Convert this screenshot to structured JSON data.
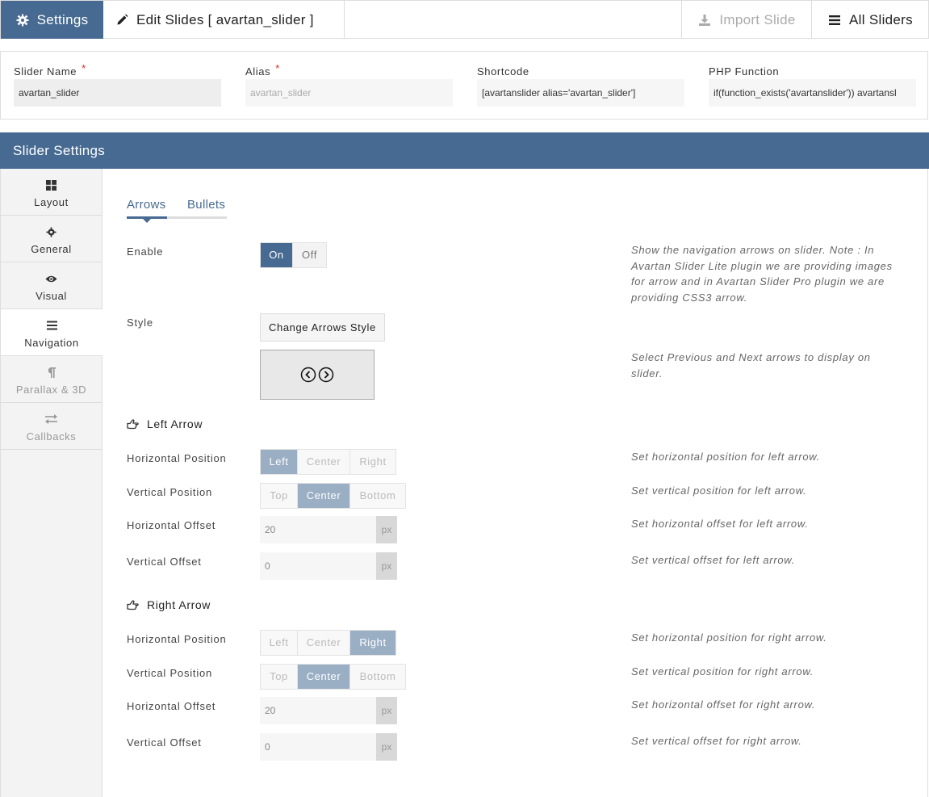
{
  "topbar": {
    "settings_label": "Settings",
    "edit_label": "Edit Slides [ avartan_slider ]",
    "import_label": "Import Slide",
    "all_label": "All Sliders"
  },
  "fields": {
    "slider_name": {
      "label": "Slider Name",
      "required": "*",
      "value": "avartan_slider"
    },
    "alias": {
      "label": "Alias",
      "required": "*",
      "value": "avartan_slider"
    },
    "shortcode": {
      "label": "Shortcode",
      "value": "[avartanslider alias='avartan_slider']"
    },
    "php": {
      "label": "PHP Function",
      "value": "if(function_exists('avartanslider')) avartansl"
    }
  },
  "settings_title": "Slider Settings",
  "sidebar": {
    "items": [
      {
        "label": "Layout",
        "icon": "grid-icon"
      },
      {
        "label": "General",
        "icon": "gear-icon"
      },
      {
        "label": "Visual",
        "icon": "eye-icon"
      },
      {
        "label": "Navigation",
        "icon": "bars-icon"
      },
      {
        "label": "Parallax & 3D",
        "icon": "paragraph-icon"
      },
      {
        "label": "Callbacks",
        "icon": "exchange-icon"
      }
    ]
  },
  "subtabs": [
    "Arrows",
    "Bullets"
  ],
  "enable": {
    "label": "Enable",
    "on": "On",
    "off": "Off",
    "desc": "Show the navigation arrows on slider. Note : In Avartan Slider Lite plugin we are providing images for arrow and in Avartan Slider Pro plugin we are providing CSS3 arrow."
  },
  "style": {
    "label": "Style",
    "button": "Change Arrows Style",
    "desc": "Select Previous and Next arrows to display on slider."
  },
  "left_arrow": {
    "title": "Left Arrow",
    "hpos": {
      "label": "Horizontal Position",
      "options": [
        "Left",
        "Center",
        "Right"
      ],
      "desc": "Set horizontal position for left arrow."
    },
    "vpos": {
      "label": "Vertical Position",
      "options": [
        "Top",
        "Center",
        "Bottom"
      ],
      "desc": "Set vertical position for left arrow."
    },
    "hoff": {
      "label": "Horizontal Offset",
      "value": "20",
      "unit": "px",
      "desc": "Set horizontal offset for left arrow."
    },
    "voff": {
      "label": "Vertical Offset",
      "value": "0",
      "unit": "px",
      "desc": "Set vertical offset for left arrow."
    }
  },
  "right_arrow": {
    "title": "Right Arrow",
    "hpos": {
      "label": "Horizontal Position",
      "options": [
        "Left",
        "Center",
        "Right"
      ],
      "desc": "Set horizontal position for right arrow."
    },
    "vpos": {
      "label": "Vertical Position",
      "options": [
        "Top",
        "Center",
        "Bottom"
      ],
      "desc": "Set vertical position for right arrow."
    },
    "hoff": {
      "label": "Horizontal Offset",
      "value": "20",
      "unit": "px",
      "desc": "Set horizontal offset for right arrow."
    },
    "voff": {
      "label": "Vertical Offset",
      "value": "0",
      "unit": "px",
      "desc": "Set vertical offset for right arrow."
    }
  },
  "colors": {
    "accent": "#466a91",
    "selected": "#9aaec4",
    "required": "#d9262a"
  }
}
